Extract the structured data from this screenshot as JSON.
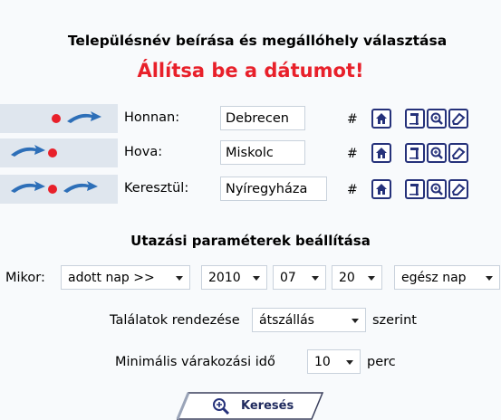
{
  "header": {
    "title": "Településnév beírása és megállóhely választása",
    "alert": "Állítsa be a dátumot!"
  },
  "stops": [
    {
      "label": "Honnan:",
      "value": "Debrecen",
      "hash": "#"
    },
    {
      "label": "Hova:",
      "value": "Miskolc",
      "hash": "#"
    },
    {
      "label": "Keresztül:",
      "value": "Nyíregyháza",
      "hash": "#"
    }
  ],
  "params": {
    "title": "Utazási paraméterek beállítása",
    "mikor_label": "Mikor:",
    "day_mode": "adott nap >>",
    "year": "2010",
    "month": "07",
    "day": "20",
    "day_part": "egész nap",
    "sort_prefix": "Találatok rendezése",
    "sort_value": "átszállás",
    "sort_suffix": "szerint",
    "wait_prefix": "Minimális várakozási idő",
    "wait_value": "10",
    "wait_suffix": "perc"
  },
  "search": {
    "label": "Keresés"
  },
  "colors": {
    "accent_red": "#e8202a",
    "icon_blue": "#25317a",
    "arrow_blue": "#2d6fb8",
    "band": "#dfe6ee"
  }
}
